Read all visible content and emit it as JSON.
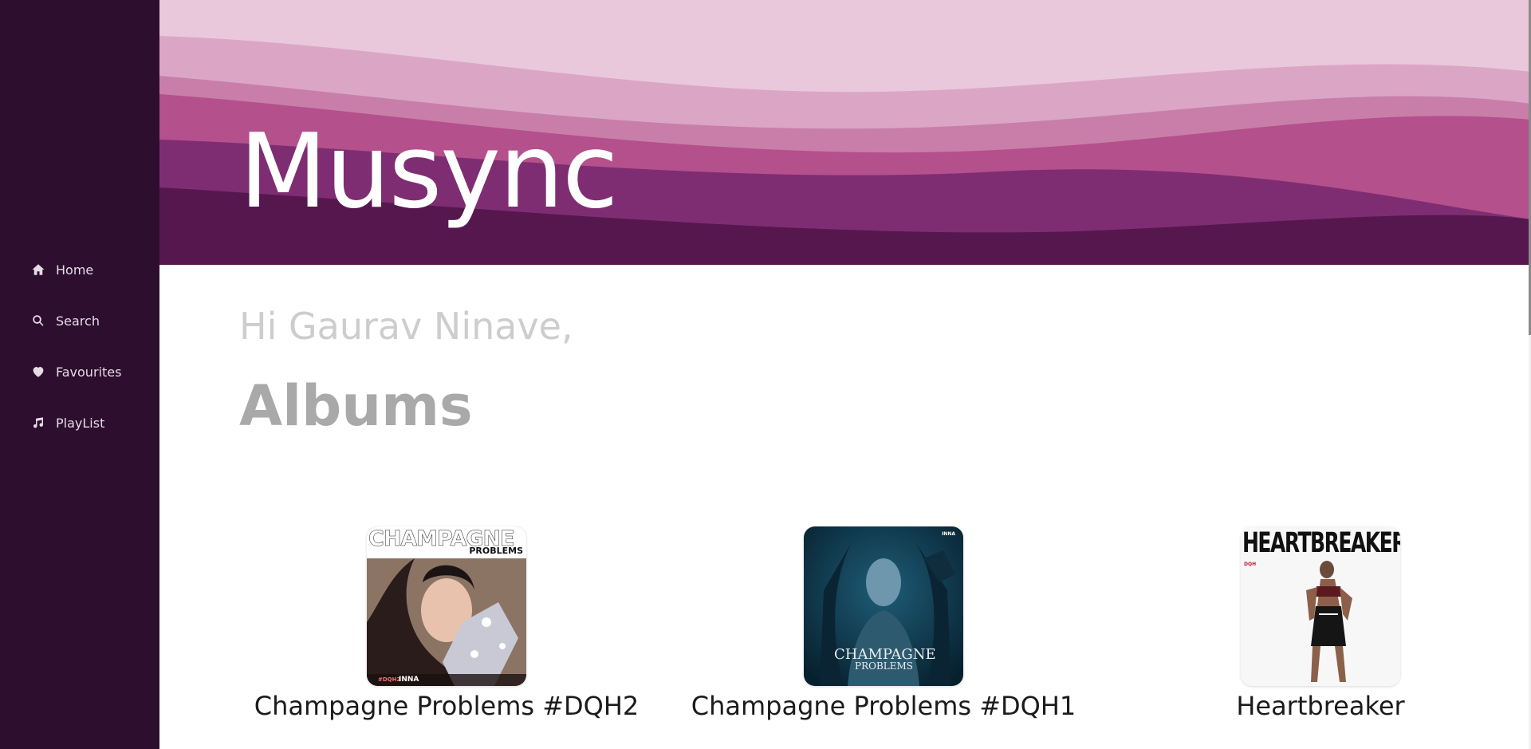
{
  "sidebar": {
    "items": [
      {
        "label": "Home",
        "icon": "home-icon"
      },
      {
        "label": "Search",
        "icon": "search-icon"
      },
      {
        "label": "Favourites",
        "icon": "heart-icon"
      },
      {
        "label": "PlayList",
        "icon": "music-note-icon"
      }
    ]
  },
  "header": {
    "title": "Musync"
  },
  "main": {
    "greeting": "Hi Gaurav Ninave,",
    "section_title": "Albums",
    "albums": [
      {
        "name": "Champagne Problems #DQH2",
        "cover_text_top": "CHAMPAGNE",
        "cover_text_sub": "PROBLEMS",
        "cover_tag": "#DQH2",
        "cover_artist": "INNA"
      },
      {
        "name": "Champagne Problems #DQH1",
        "cover_text_top": "CHAMPAGNE",
        "cover_text_sub": "PROBLEMS",
        "cover_artist": "INNA"
      },
      {
        "name": "Heartbreaker",
        "cover_text_top": "HEARTBREAKER",
        "cover_tag": "DQH"
      }
    ]
  },
  "colors": {
    "sidebar_bg": "#2d0e2f",
    "banner_light": "#e9c8dc",
    "banner_dark": "#4f1450",
    "accent_pink": "#b4508c"
  }
}
